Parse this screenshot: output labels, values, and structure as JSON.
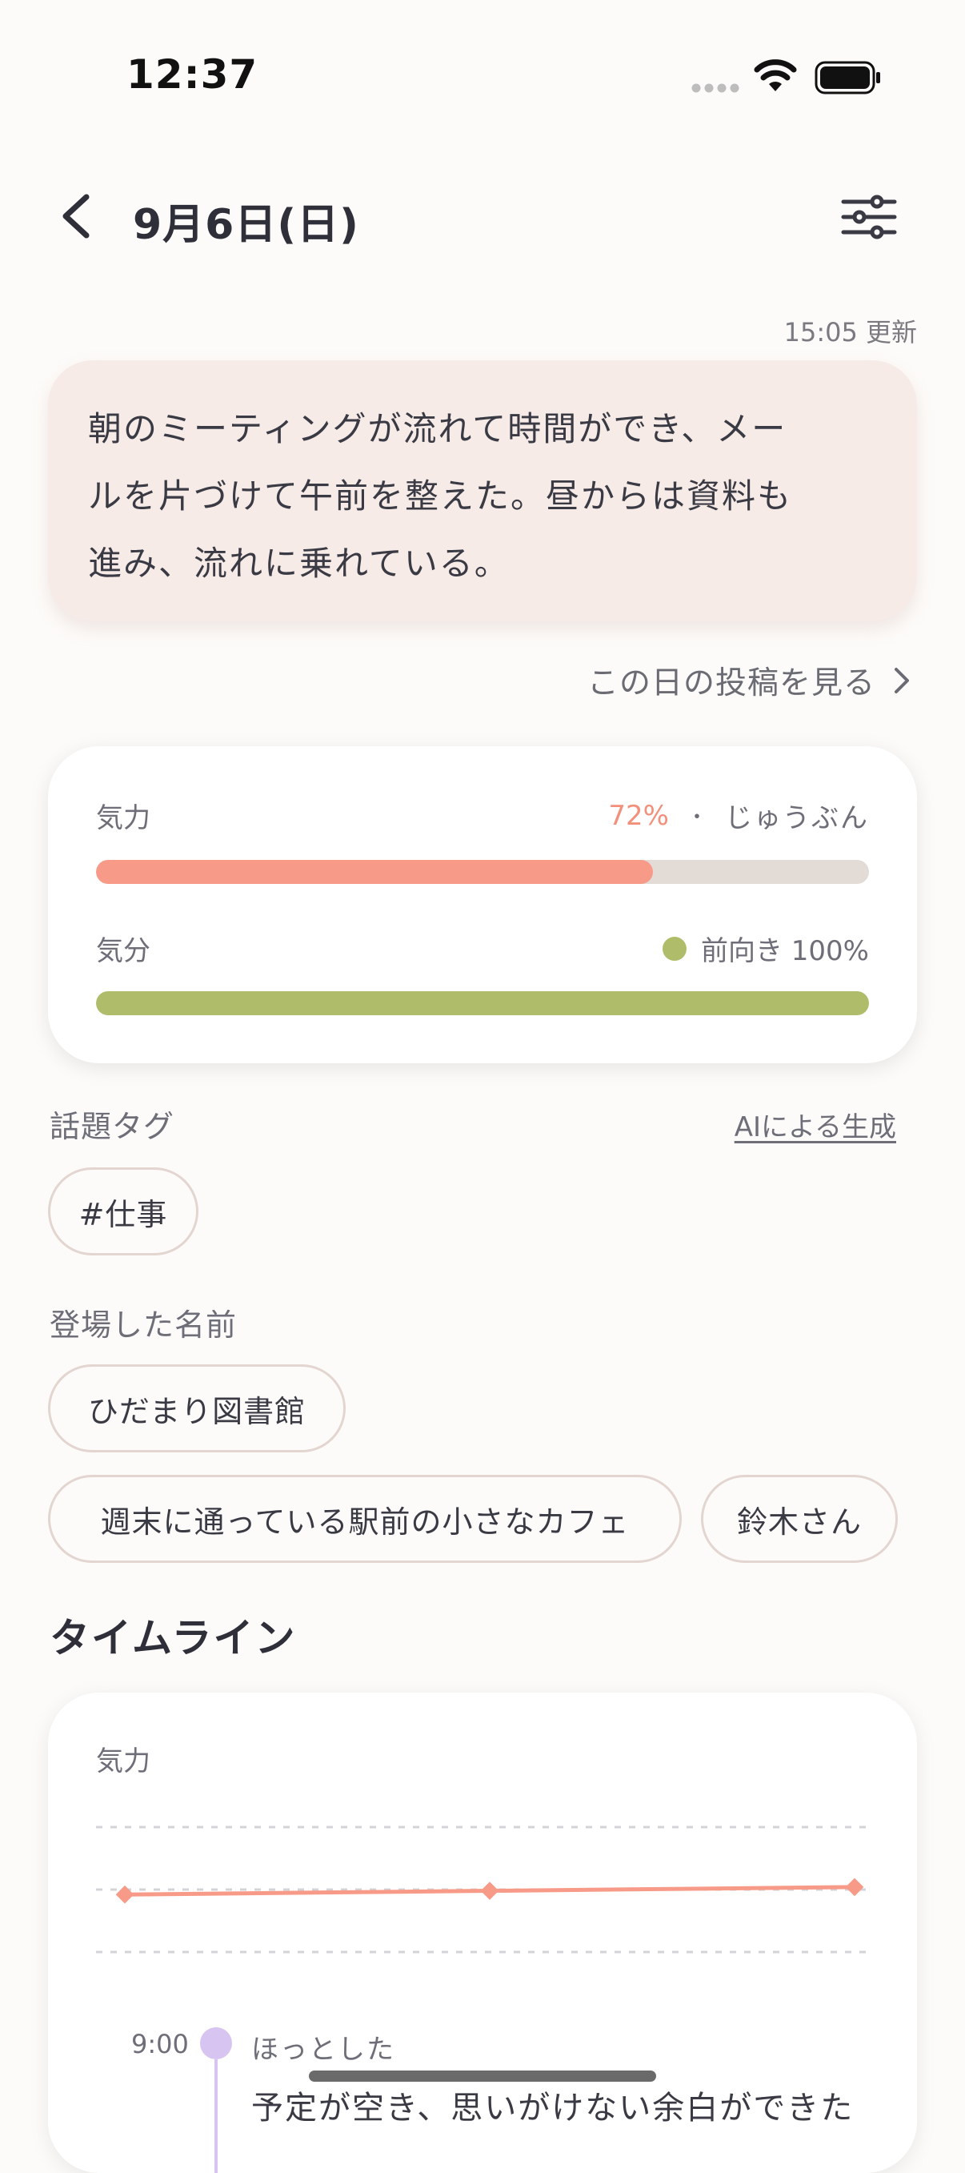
{
  "status_bar": {
    "time": "12:37"
  },
  "header": {
    "date": "9月6日(日)"
  },
  "summary": {
    "updated": "15:05 更新",
    "lines": [
      "朝のミーティングが流れて時間ができ、メー",
      "ルを片づけて午前を整えた。昼からは資料も",
      "進み、流れに乗れている。"
    ]
  },
  "posts_link": "この日の投稿を見る",
  "energy": {
    "label": "気力",
    "percent_text": "72%",
    "percent": 72,
    "separator": "・",
    "status": "じゅうぶん",
    "color": "#f89a88"
  },
  "mood": {
    "label": "気分",
    "status": "前向き 100%",
    "percent": 100,
    "color": "#afbd6a"
  },
  "topic_tags": {
    "label": "話題タグ",
    "ai_label": "AIによる生成",
    "tags": [
      "#仕事"
    ]
  },
  "names": {
    "label": "登場した名前",
    "items": [
      "ひだまり図書館",
      "週末に通っている駅前の小さなカフェ",
      "鈴木さん"
    ]
  },
  "timeline": {
    "title": "タイムライン",
    "chart_label": "気力",
    "entry": {
      "time": "9:00",
      "title": "ほっとした",
      "text": "予定が空き、思いがけない余白ができた"
    }
  },
  "chart_data": {
    "type": "line",
    "title": "",
    "xlabel": "",
    "ylabel": "",
    "x": [
      1,
      2,
      3
    ],
    "series": [
      {
        "values": [
          0.46,
          0.49,
          0.52
        ]
      }
    ],
    "ylim": [
      0,
      1
    ],
    "grid": true
  }
}
